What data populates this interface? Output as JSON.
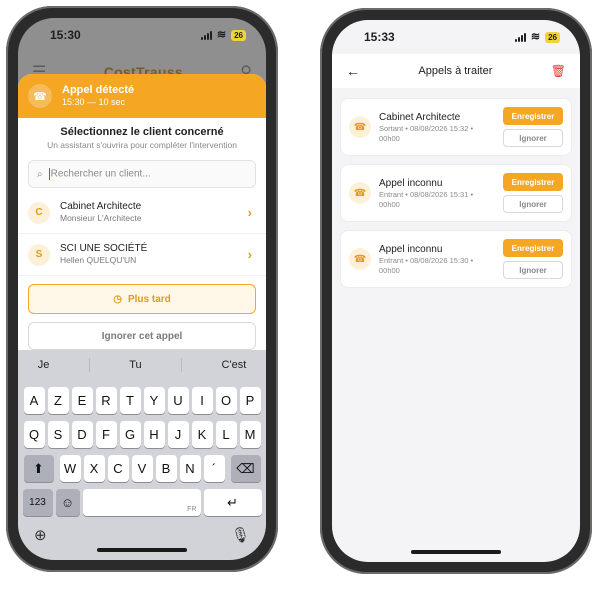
{
  "left": {
    "status": {
      "time": "15:30",
      "battery": "26"
    },
    "background_app": {
      "logo": "CostTrauss"
    },
    "call_banner": {
      "title": "Appel détecté",
      "subtitle": "15:30 — 10 sec"
    },
    "select": {
      "title": "Sélectionnez le client concerné",
      "subtitle": "Un assistant s'ouvrira pour compléter l'intervention"
    },
    "search": {
      "placeholder": "Rechercher un client..."
    },
    "clients": [
      {
        "initial": "C",
        "name": "Cabinet Architecte",
        "contact": "Monsieur L'Architecte"
      },
      {
        "initial": "S",
        "name": "SCI UNE SOCIÉTÉ",
        "contact": "Hellen QUELQU'UN"
      }
    ],
    "later_label": "Plus tard",
    "ignore_label": "Ignorer cet appel",
    "keyboard": {
      "suggestions": [
        "Je",
        "Tu",
        "C'est"
      ],
      "row1": [
        "A",
        "Z",
        "E",
        "R",
        "T",
        "Y",
        "U",
        "I",
        "O",
        "P"
      ],
      "row2": [
        "Q",
        "S",
        "D",
        "F",
        "G",
        "H",
        "J",
        "K",
        "L",
        "M"
      ],
      "row3": [
        "W",
        "X",
        "C",
        "V",
        "B",
        "N",
        "´"
      ],
      "numbers_label": "123",
      "space_lang": "FR"
    }
  },
  "right": {
    "status": {
      "time": "15:33",
      "battery": "26"
    },
    "nav": {
      "title": "Appels à traiter"
    },
    "calls": [
      {
        "name": "Cabinet Architecte",
        "direction": "Sortant",
        "date": "08/08/2026",
        "time": "15:32",
        "duration": "00h00"
      },
      {
        "name": "Appel inconnu",
        "direction": "Entrant",
        "date": "08/08/2026",
        "time": "15:31",
        "duration": "00h00"
      },
      {
        "name": "Appel inconnu",
        "direction": "Entrant",
        "date": "08/08/2026",
        "time": "15:30",
        "duration": "00h00"
      }
    ],
    "register_label": "Enregistrer",
    "ignore_label": "Ignorer"
  },
  "colors": {
    "accent": "#f5a623",
    "danger": "#e53935"
  }
}
